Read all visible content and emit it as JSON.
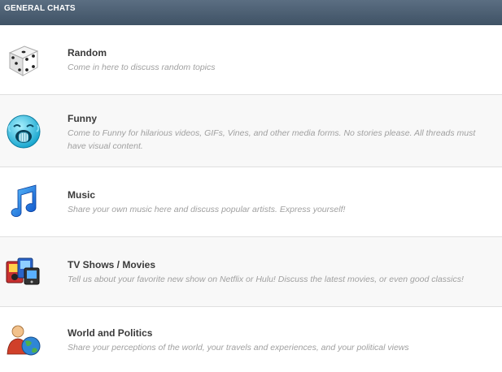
{
  "header": {
    "title": "GENERAL CHATS"
  },
  "forums": [
    {
      "title": "Random",
      "description": "Come in here to discuss random topics",
      "icon": "dice-icon"
    },
    {
      "title": "Funny",
      "description": "Come to Funny for hilarious videos, GIFs, Vines, and other media forms. No stories please. All threads must have visual content.",
      "icon": "laughing-face-icon"
    },
    {
      "title": "Music",
      "description": "Share your own music here and discuss popular artists. Express yourself!",
      "icon": "music-note-icon"
    },
    {
      "title": "TV Shows / Movies",
      "description": "Tell us about your favorite new show on Netflix or Hulu! Discuss the latest movies, or even good classics!",
      "icon": "tv-movies-icon"
    },
    {
      "title": "World and Politics",
      "description": "Share your perceptions of the world, your travels and experiences, and your political views",
      "icon": "globe-person-icon"
    }
  ],
  "colors": {
    "header": "#4a5d71",
    "title": "#3a3a3a",
    "description": "#a0a0a0",
    "alt_row": "#f8f8f8"
  }
}
